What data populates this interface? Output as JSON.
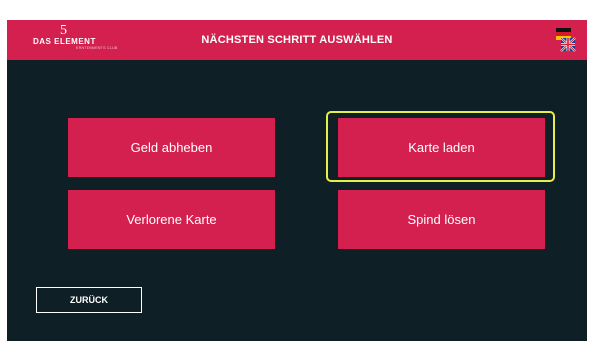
{
  "header": {
    "logo_main": "DAS ELEMENT",
    "logo_sub": "ERNTEBMENTS CLUB",
    "logo_number": "5",
    "title": "NÄCHSTEN SCHRITT AUSWÄHLEN",
    "language_icon": "de-uk-flag-icon"
  },
  "actions": [
    {
      "label": "Geld abheben"
    },
    {
      "label": "Karte laden"
    },
    {
      "label": "Verlorene Karte"
    },
    {
      "label": "Spind lösen"
    }
  ],
  "selected_action": "Karte laden",
  "back_button": {
    "label": "ZURÜCK"
  },
  "colors": {
    "brand": "#d3204f",
    "background": "#0e1f26",
    "highlight": "#e6ef4a"
  }
}
